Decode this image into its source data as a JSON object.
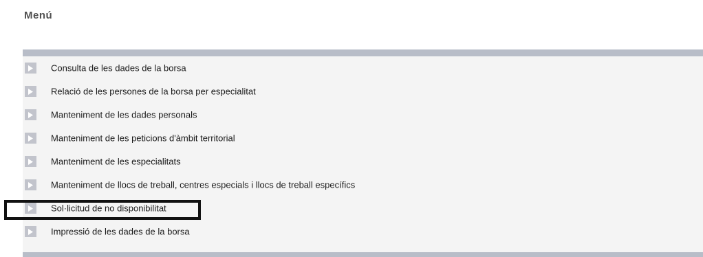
{
  "menu": {
    "title": "Menú",
    "items": [
      {
        "label": "Consulta de les dades de la borsa",
        "icon": "arrow-right-icon"
      },
      {
        "label": "Relació de les persones de la borsa per especialitat",
        "icon": "arrow-right-icon"
      },
      {
        "label": "Manteniment de les dades personals",
        "icon": "arrow-right-icon"
      },
      {
        "label": "Manteniment de les peticions d'àmbit territorial",
        "icon": "arrow-right-icon"
      },
      {
        "label": "Manteniment de les especialitats",
        "icon": "arrow-right-icon"
      },
      {
        "label": "Manteniment de llocs de treball, centres especials i llocs de treball específics",
        "icon": "arrow-right-icon"
      },
      {
        "label": "Sol·licitud de no disponibilitat",
        "icon": "arrow-right-icon",
        "highlighted": true
      },
      {
        "label": "Impressió de les dades de la borsa",
        "icon": "arrow-right-icon"
      }
    ]
  },
  "colors": {
    "bar": "#b8bdc8",
    "panel": "#f4f4f4",
    "icon_bg": "#c2c4cc",
    "icon_arrow": "#ffffff",
    "highlight_border": "#111111"
  }
}
